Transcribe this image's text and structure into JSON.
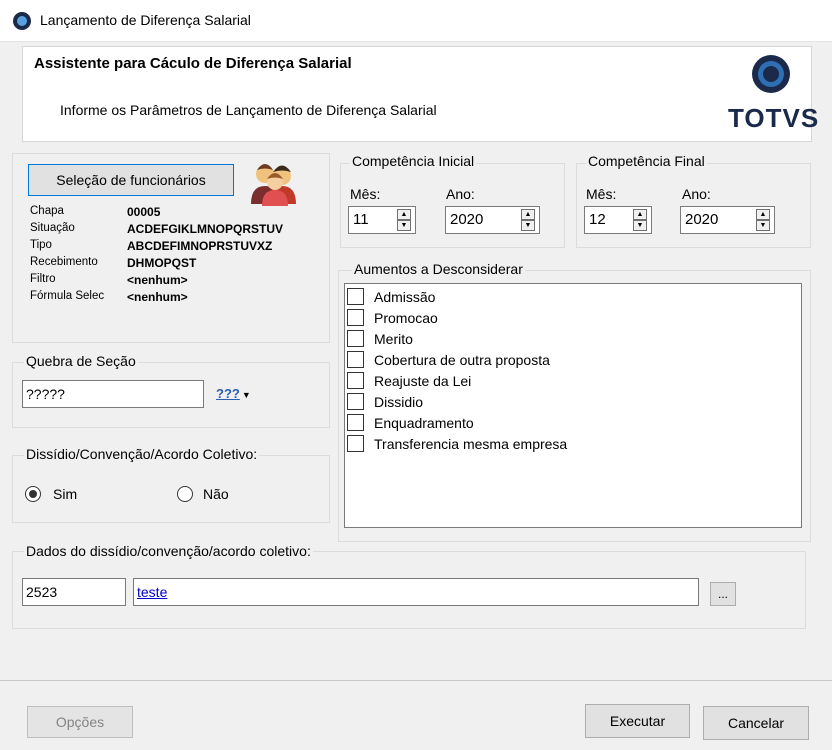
{
  "window": {
    "title": "Lançamento de Diferença Salarial"
  },
  "header": {
    "title": "Assistente para Cáculo de Diferença Salarial",
    "subtitle": "Informe os Parâmetros de Lançamento de Diferença Salarial",
    "logo_text": "TOTVS"
  },
  "employees": {
    "button_label": "Seleção de funcionários",
    "rows": [
      {
        "label": "Chapa",
        "value": "00005"
      },
      {
        "label": "Situação",
        "value": "ACDEFGIKLMNOPQRSTUV"
      },
      {
        "label": "Tipo",
        "value": "ABCDEFIMNOPRSTUVXZ"
      },
      {
        "label": "Recebimento",
        "value": "DHMOPQST"
      },
      {
        "label": "Filtro",
        "value": "<nenhum>"
      },
      {
        "label": "Fórmula Selec",
        "value": "<nenhum>"
      }
    ]
  },
  "competencia_inicial": {
    "legend": "Competência Inicial",
    "mes_label": "Mês:",
    "mes_value": "11",
    "ano_label": "Ano:",
    "ano_value": "2020"
  },
  "competencia_final": {
    "legend": "Competência Final",
    "mes_label": "Mês:",
    "mes_value": "12",
    "ano_label": "Ano:",
    "ano_value": "2020"
  },
  "aumentos": {
    "legend": "Aumentos a Desconsiderar",
    "items": [
      "Admissão",
      "Promocao",
      "Merito",
      "Cobertura de outra proposta",
      "Reajuste da Lei",
      "Dissidio",
      "Enquadramento",
      "Transferencia mesma empresa"
    ]
  },
  "quebra": {
    "legend": "Quebra de Seção",
    "value": "?????",
    "picker_label": "???"
  },
  "dissidio": {
    "legend": "Dissídio/Convenção/Acordo Coletivo:",
    "sim_label": "Sim",
    "nao_label": "Não",
    "selected": "Sim"
  },
  "dados": {
    "legend": "Dados do dissídio/convenção/acordo coletivo:",
    "code": "2523",
    "description": "teste",
    "browse_label": "..."
  },
  "footer": {
    "options_label": "Opções",
    "execute_label": "Executar",
    "cancel_label": "Cancelar"
  }
}
